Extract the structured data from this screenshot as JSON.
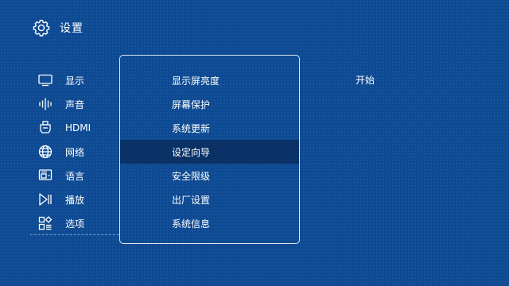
{
  "header": {
    "title": "设置",
    "icon": "gear-icon"
  },
  "sidebar": {
    "items": [
      {
        "label": "显示",
        "icon": "monitor-icon"
      },
      {
        "label": "声音",
        "icon": "sound-wave-icon"
      },
      {
        "label": "HDMI",
        "icon": "hdmi-icon"
      },
      {
        "label": "网络",
        "icon": "globe-icon"
      },
      {
        "label": "语言",
        "icon": "language-icon"
      },
      {
        "label": "播放",
        "icon": "play-pause-icon"
      },
      {
        "label": "选项",
        "icon": "options-icon"
      }
    ]
  },
  "menu": {
    "selected_index": 3,
    "items": [
      {
        "label": "显示屏亮度"
      },
      {
        "label": "屏幕保护"
      },
      {
        "label": "系统更新"
      },
      {
        "label": "设定向导"
      },
      {
        "label": "安全限级"
      },
      {
        "label": "出厂设置"
      },
      {
        "label": "系统信息"
      }
    ]
  },
  "action": {
    "label": "开始"
  },
  "colors": {
    "background": "#0d4a93",
    "selected_row": "#08224a",
    "text": "#ffffff"
  }
}
